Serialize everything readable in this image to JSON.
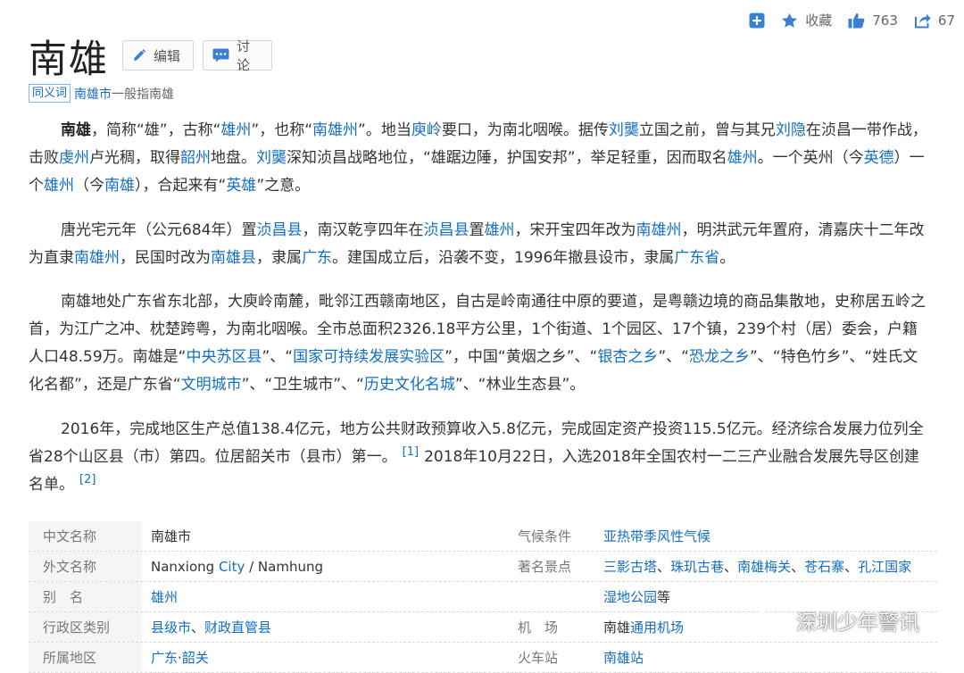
{
  "header": {
    "title": "南雄",
    "edit_label": "编辑",
    "discuss_label": "讨论"
  },
  "toolbar": {
    "favorite_label": "收藏",
    "like_count": "763",
    "share_count": "67"
  },
  "synonym": {
    "tag": "同义词",
    "term": "南雄市",
    "rest": "一般指南雄"
  },
  "p1": [
    {
      "t": "南雄",
      "b": true
    },
    {
      "t": "，简称“雄”，古称“"
    },
    {
      "t": "雄州",
      "l": true
    },
    {
      "t": "”，也称“"
    },
    {
      "t": "南雄州",
      "l": true
    },
    {
      "t": "”。地当"
    },
    {
      "t": "庾岭",
      "l": true
    },
    {
      "t": "要口，为南北咽喉。据传"
    },
    {
      "t": "刘龑",
      "l": true
    },
    {
      "t": "立国之前，曾与其兄"
    },
    {
      "t": "刘隐",
      "l": true
    },
    {
      "t": "在浈昌一带作战，击败"
    },
    {
      "t": "虔州",
      "l": true
    },
    {
      "t": "卢光稠，取得"
    },
    {
      "t": "韶州",
      "l": true
    },
    {
      "t": "地盘。"
    },
    {
      "t": "刘龑",
      "l": true
    },
    {
      "t": "深知浈昌战略地位，“雄踞边陲，护国安邦”，举足轻重，因而取名"
    },
    {
      "t": "雄州",
      "l": true
    },
    {
      "t": "。一个英州（今"
    },
    {
      "t": "英德",
      "l": true
    },
    {
      "t": "）一个"
    },
    {
      "t": "雄州",
      "l": true
    },
    {
      "t": "（今"
    },
    {
      "t": "南雄",
      "l": true
    },
    {
      "t": "），合起来有“"
    },
    {
      "t": "英雄",
      "l": true
    },
    {
      "t": "”之意。"
    }
  ],
  "p2": [
    {
      "t": "唐光宅元年（公元684年）置"
    },
    {
      "t": "浈昌县",
      "l": true
    },
    {
      "t": "，南汉乾亨四年在"
    },
    {
      "t": "浈昌县",
      "l": true
    },
    {
      "t": "置"
    },
    {
      "t": "雄州",
      "l": true
    },
    {
      "t": "，宋开宝四年改为"
    },
    {
      "t": "南雄州",
      "l": true
    },
    {
      "t": "，明洪武元年置府，清嘉庆十二年改为直隶"
    },
    {
      "t": "南雄州",
      "l": true
    },
    {
      "t": "，民国时改为"
    },
    {
      "t": "南雄县",
      "l": true
    },
    {
      "t": "，隶属"
    },
    {
      "t": "广东",
      "l": true
    },
    {
      "t": "。建国成立后，沿袭不变，1996年撤县设市，隶属"
    },
    {
      "t": "广东省",
      "l": true
    },
    {
      "t": "。"
    }
  ],
  "p3": [
    {
      "t": "南雄地处广东省东北部，大庾岭南麓，毗邻江西赣南地区，自古是岭南通往中原的要道，是粤赣边境的商品集散地，史称居五岭之首，为江广之冲、枕楚跨粤，为南北咽喉。全市总面积2326.18平方公里，1个街道、1个园区、17个镇，239个村（居）委会，户籍人口48.59万。南雄是“"
    },
    {
      "t": "中央苏区县",
      "l": true
    },
    {
      "t": "”、“"
    },
    {
      "t": "国家可持续发展实验区",
      "l": true
    },
    {
      "t": "”，中国“黄烟之乡”、“"
    },
    {
      "t": "银杏之乡",
      "l": true
    },
    {
      "t": "”、“"
    },
    {
      "t": "恐龙之乡",
      "l": true
    },
    {
      "t": "”、“特色竹乡”、“姓氏文化名都”，还是广东省“"
    },
    {
      "t": "文明城市",
      "l": true
    },
    {
      "t": "”、“卫生城市”、“"
    },
    {
      "t": "历史文化名城",
      "l": true
    },
    {
      "t": "”、“林业生态县”。"
    }
  ],
  "p4": [
    {
      "t": "2016年，完成地区生产总值138.4亿元，地方公共财政预算收入5.8亿元，完成固定资产投资115.5亿元。经济综合发展力位列全省28个山区县（市）第四。位居韶关市（县市）第一。"
    },
    {
      "t": "[1]",
      "r": true
    },
    {
      "t": "2018年10月22日，入选2018年全国农村一二三产业融合发展先导区创建名单。"
    },
    {
      "t": "[2]",
      "r": true
    }
  ],
  "info_rows": [
    {
      "k1": "中文名称",
      "v1": [
        {
          "t": "南雄市"
        }
      ],
      "k2": "气候条件",
      "v2": [
        {
          "t": "亚热带季风性气候",
          "l": true
        }
      ]
    },
    {
      "k1": "外文名称",
      "v1": [
        {
          "t": "Nanxiong "
        },
        {
          "t": "City",
          "l": true
        },
        {
          "t": " / Namhung"
        }
      ],
      "k2": "著名景点",
      "v2": [
        {
          "t": "三影古塔",
          "l": true
        },
        {
          "t": "、"
        },
        {
          "t": "珠玑古巷",
          "l": true
        },
        {
          "t": "、"
        },
        {
          "t": "南雄梅关",
          "l": true
        },
        {
          "t": "、"
        },
        {
          "t": "苍石寨",
          "l": true
        },
        {
          "t": "、"
        },
        {
          "t": "孔江国家",
          "l": true
        }
      ]
    },
    {
      "k1": "别　名",
      "v1": [
        {
          "t": "雄州",
          "l": true
        }
      ],
      "k2": "",
      "v2": [
        {
          "t": "湿地公园",
          "l": true
        },
        {
          "t": "等"
        }
      ]
    },
    {
      "k1": "行政区类别",
      "v1": [
        {
          "t": "县级市",
          "l": true
        },
        {
          "t": "、"
        },
        {
          "t": "财政直管县",
          "l": true
        }
      ],
      "k2": "机　场",
      "v2": [
        {
          "t": "南雄"
        },
        {
          "t": "通用机场",
          "l": true
        }
      ]
    },
    {
      "k1": "所属地区",
      "v1": [
        {
          "t": "广东",
          "l": true
        },
        {
          "t": "·"
        },
        {
          "t": "韶关",
          "l": true
        }
      ],
      "k2": "火车站",
      "v2": [
        {
          "t": "南雄站",
          "l": true
        }
      ]
    }
  ],
  "watermark": {
    "text": "深圳少年警讯"
  },
  "colors": {
    "link": "#136ec2",
    "text": "#333333",
    "label_bg": "#f5f5f5"
  }
}
